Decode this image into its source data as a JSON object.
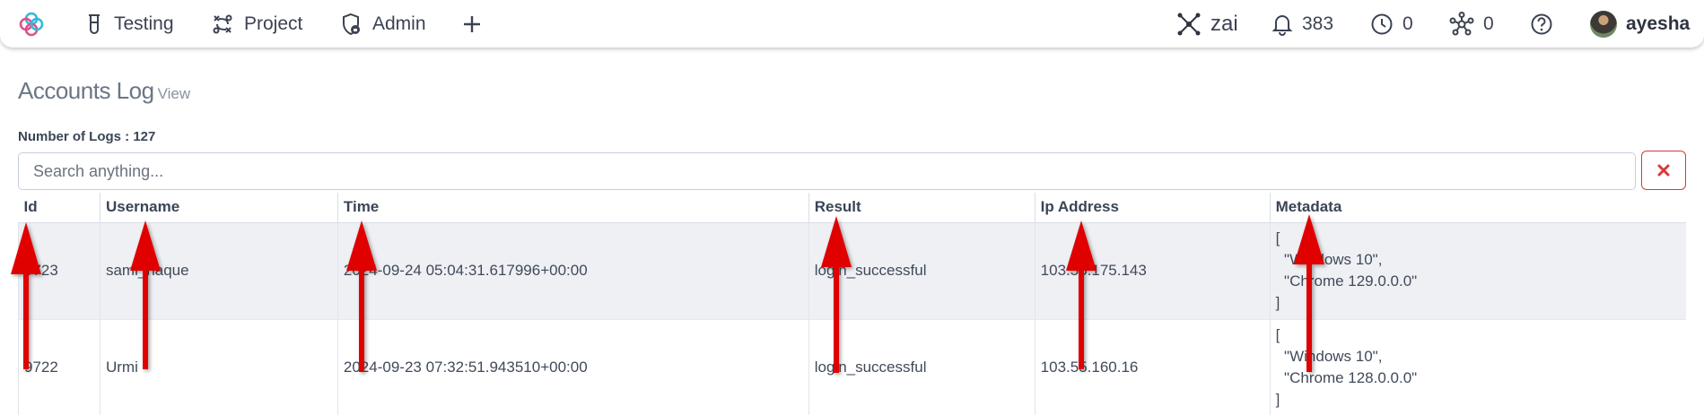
{
  "nav": {
    "items": [
      {
        "label": "Testing",
        "icon": "flask-icon"
      },
      {
        "label": "Project",
        "icon": "flow-icon"
      },
      {
        "label": "Admin",
        "icon": "shield-icon"
      }
    ],
    "add_icon": "plus-icon",
    "workspace": "zai",
    "notifications": "383",
    "pending": "0",
    "network": "0",
    "user": "ayesha"
  },
  "page": {
    "title": "Accounts Log",
    "title_sub": "View",
    "count_label": "Number of Logs : 127"
  },
  "search": {
    "placeholder": "Search anything...",
    "value": ""
  },
  "table": {
    "headers": [
      "Id",
      "Username",
      "Time",
      "Result",
      "Ip Address",
      "Metadata"
    ],
    "rows": [
      {
        "id": "9723",
        "username": "sami_haque",
        "time": "2024-09-24 05:04:31.617996+00:00",
        "result": "login_successful",
        "ip": "103.55.175.143",
        "meta": [
          "[",
          "  \"Windows 10\",",
          "  \"Chrome 129.0.0.0\"",
          "]"
        ]
      },
      {
        "id": "9722",
        "username": "Urmi",
        "time": "2024-09-23 07:32:51.943510+00:00",
        "result": "login_successful",
        "ip": "103.55.160.16",
        "meta": [
          "[",
          "  \"Windows 10\",",
          "  \"Chrome 128.0.0.0\"",
          "]"
        ]
      }
    ]
  },
  "colors": {
    "arrow": "#e00000",
    "clear_icon": "#d93a3a",
    "logo_a": "#35b9d8",
    "logo_b": "#e04f8a"
  }
}
